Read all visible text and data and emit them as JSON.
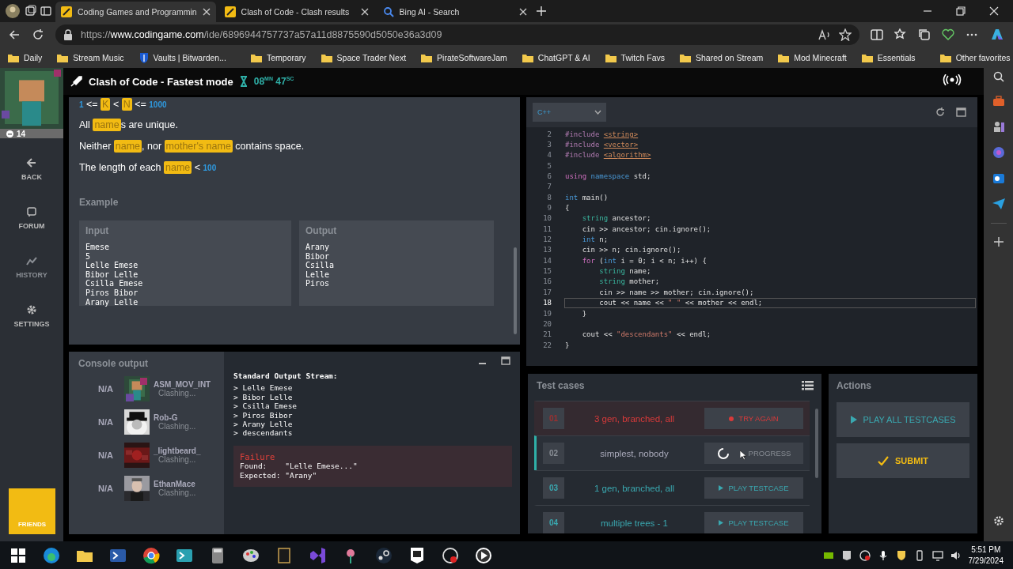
{
  "browser": {
    "tabs": [
      {
        "title": "Coding Games and Programmin",
        "selected": true,
        "kind": "codingame"
      },
      {
        "title": "Clash of Code - Clash results",
        "selected": false,
        "kind": "codingame"
      },
      {
        "title": "Bing AI - Search",
        "selected": false,
        "kind": "search"
      }
    ],
    "url": {
      "scheme": "https://",
      "host": "www.codingame.com",
      "path": "/ide/6896944757737a57a11d8875590d5050e36a3d09"
    },
    "bookmarks": [
      {
        "label": "Daily",
        "kind": "folder"
      },
      {
        "label": "Stream Music",
        "kind": "folder"
      },
      {
        "label": "Vaults | Bitwarden...",
        "kind": "shield"
      },
      {
        "label": "Temporary",
        "kind": "folder"
      },
      {
        "label": "Space Trader Next",
        "kind": "folder"
      },
      {
        "label": "PirateSoftwareJam",
        "kind": "folder"
      },
      {
        "label": "ChatGPT & AI",
        "kind": "folder"
      },
      {
        "label": "Twitch Favs",
        "kind": "folder"
      },
      {
        "label": "Shared on Stream",
        "kind": "folder"
      },
      {
        "label": "Mod Minecraft",
        "kind": "folder"
      },
      {
        "label": "Essentials",
        "kind": "folder"
      }
    ],
    "other_favorites": "Other favorites"
  },
  "nav": {
    "level": "14",
    "items": [
      {
        "label": "BACK",
        "kind": "back",
        "disabled": false
      },
      {
        "label": "FORUM",
        "kind": "forum",
        "disabled": false
      },
      {
        "label": "HISTORY",
        "kind": "history",
        "disabled": true
      },
      {
        "label": "SETTINGS",
        "kind": "settings",
        "disabled": false
      }
    ],
    "friends": "FRIENDS"
  },
  "header": {
    "title": "Clash of Code - Fastest mode",
    "timer": "08$^{MN}$ 47$^{SC}$"
  },
  "statement": {
    "paragraphs": [
      [
        {
          "kind": "const",
          "text": "1"
        },
        {
          "kind": "text",
          "text": " <= "
        },
        {
          "kind": "var",
          "text": "K"
        },
        {
          "kind": "text",
          "text": " < "
        },
        {
          "kind": "var",
          "text": "N"
        },
        {
          "kind": "text",
          "text": " <= "
        },
        {
          "kind": "const",
          "text": "1000"
        }
      ],
      [
        {
          "kind": "text",
          "text": "All "
        },
        {
          "kind": "var",
          "text": "name"
        },
        {
          "kind": "text",
          "text": "s are unique."
        }
      ],
      [
        {
          "kind": "text",
          "text": "Neither "
        },
        {
          "kind": "var",
          "text": "name"
        },
        {
          "kind": "text",
          "text": ", nor "
        },
        {
          "kind": "var",
          "text": "mother's name"
        },
        {
          "kind": "text",
          "text": " contains space."
        }
      ],
      [
        {
          "kind": "text",
          "text": "The length of each "
        },
        {
          "kind": "var",
          "text": "name"
        },
        {
          "kind": "text",
          "text": " < "
        },
        {
          "kind": "const",
          "text": "100"
        }
      ]
    ],
    "example_title": "Example",
    "input": {
      "title": "Input",
      "lines": [
        "Emese",
        "5",
        "Lelle Emese",
        "Bibor Lelle",
        "Csilla Emese",
        "Piros Bibor",
        "Arany Lelle"
      ]
    },
    "output": {
      "title": "Output",
      "lines": [
        "Arany",
        "Bibor",
        "Csilla",
        "Lelle",
        "Piros"
      ]
    }
  },
  "editor": {
    "language": "C++",
    "lines": [
      {
        "number": "2",
        "current": false,
        "tokens": [
          {
            "kind": "pp",
            "text": "#include "
          },
          {
            "kind": "inc",
            "text": "<string>"
          }
        ]
      },
      {
        "number": "3",
        "current": false,
        "tokens": [
          {
            "kind": "pp",
            "text": "#include "
          },
          {
            "kind": "inc",
            "text": "<vector>"
          }
        ]
      },
      {
        "number": "4",
        "current": false,
        "tokens": [
          {
            "kind": "pp",
            "text": "#include "
          },
          {
            "kind": "inc",
            "text": "<algorithm>"
          }
        ]
      },
      {
        "number": "5",
        "current": false
      },
      {
        "number": "6",
        "current": false,
        "tokens": [
          {
            "kind": "kw",
            "text": "using "
          },
          {
            "kind": "type",
            "text": "namespace "
          },
          {
            "kind": "plain",
            "text": "std;"
          }
        ]
      },
      {
        "number": "7",
        "current": false
      },
      {
        "number": "8",
        "current": false,
        "tokens": [
          {
            "kind": "type",
            "text": "int "
          },
          {
            "kind": "plain",
            "text": "main()"
          }
        ]
      },
      {
        "number": "9",
        "current": false,
        "tokens": [
          {
            "kind": "plain",
            "text": "{"
          }
        ]
      },
      {
        "number": "10",
        "current": false,
        "tokens": [
          {
            "kind": "cls",
            "text": "    string "
          },
          {
            "kind": "plain",
            "text": "ancestor;"
          }
        ]
      },
      {
        "number": "11",
        "current": false,
        "tokens": [
          {
            "kind": "plain",
            "text": "    cin >> ancestor; cin.ignore();"
          }
        ]
      },
      {
        "number": "12",
        "current": false,
        "tokens": [
          {
            "kind": "type",
            "text": "    int "
          },
          {
            "kind": "plain",
            "text": "n;"
          }
        ]
      },
      {
        "number": "13",
        "current": false,
        "tokens": [
          {
            "kind": "plain",
            "text": "    cin >> n; cin.ignore();"
          }
        ]
      },
      {
        "number": "14",
        "current": false,
        "tokens": [
          {
            "kind": "kw",
            "text": "    for "
          },
          {
            "kind": "plain",
            "text": "("
          },
          {
            "kind": "type",
            "text": "int "
          },
          {
            "kind": "plain",
            "text": "i = 0; i < n; i++) {"
          }
        ]
      },
      {
        "number": "15",
        "current": false,
        "tokens": [
          {
            "kind": "cls",
            "text": "        string "
          },
          {
            "kind": "plain",
            "text": "name;"
          }
        ]
      },
      {
        "number": "16",
        "current": false,
        "tokens": [
          {
            "kind": "cls",
            "text": "        string "
          },
          {
            "kind": "plain",
            "text": "mother;"
          }
        ]
      },
      {
        "number": "17",
        "current": false,
        "tokens": [
          {
            "kind": "plain",
            "text": "        cin >> name >> mother; cin.ignore();"
          }
        ]
      },
      {
        "number": "18",
        "current": true,
        "tokens": [
          {
            "kind": "plain",
            "text": "        cout << name << "
          },
          {
            "kind": "str",
            "text": "\" \""
          },
          {
            "kind": "plain",
            "text": " << mother << endl;"
          }
        ]
      },
      {
        "number": "19",
        "current": false,
        "tokens": [
          {
            "kind": "plain",
            "text": "    }"
          }
        ]
      },
      {
        "number": "20",
        "current": false
      },
      {
        "number": "21",
        "current": false,
        "tokens": [
          {
            "kind": "plain",
            "text": "    cout << "
          },
          {
            "kind": "str",
            "text": "\"descendants\""
          },
          {
            "kind": "plain",
            "text": " << endl;"
          }
        ]
      },
      {
        "number": "22",
        "current": false,
        "tokens": [
          {
            "kind": "plain",
            "text": "}"
          }
        ]
      }
    ]
  },
  "console": {
    "title": "Console output",
    "players": [
      {
        "rank": "N/A",
        "name": "ASM_MOV_INT",
        "status": "Clashing..."
      },
      {
        "rank": "N/A",
        "name": "Rob-G",
        "status": "Clashing..."
      },
      {
        "rank": "N/A",
        "name": "_lightbeard_",
        "status": "Clashing..."
      },
      {
        "rank": "N/A",
        "name": "EthanMace",
        "status": "Clashing..."
      }
    ],
    "stream_title": "Standard Output Stream:",
    "stream_lines": [
      "> Lelle Emese",
      "> Bibor Lelle",
      "> Csilla Emese",
      "> Piros Bibor",
      "> Arany Lelle",
      "> descendants"
    ],
    "failure": {
      "title": "Failure",
      "found": "Found:    \"Lelle Emese...\"",
      "expected": "Expected: \"Arany\""
    }
  },
  "testcases": {
    "title": "Test cases",
    "items": [
      {
        "number": "01",
        "name": "3 gen, branched, all",
        "kind": "failed",
        "action": "TRY AGAIN",
        "selected": false
      },
      {
        "number": "02",
        "name": "simplest, nobody",
        "kind": "running",
        "action": "PROGRESS",
        "selected": true
      },
      {
        "number": "03",
        "name": "1 gen, branched, all",
        "kind": "idle",
        "action": "PLAY TESTCASE",
        "selected": false
      },
      {
        "number": "04",
        "name": "multiple trees - 1",
        "kind": "idle",
        "action": "PLAY TESTCASE",
        "selected": false
      }
    ]
  },
  "actions": {
    "title": "Actions",
    "buttons": [
      {
        "label": "PLAY ALL TESTCASES",
        "kind": "play"
      },
      {
        "label": "SUBMIT",
        "kind": "submit"
      }
    ]
  },
  "taskbar": {
    "time": "5:51 PM",
    "date": "7/29/2024"
  }
}
